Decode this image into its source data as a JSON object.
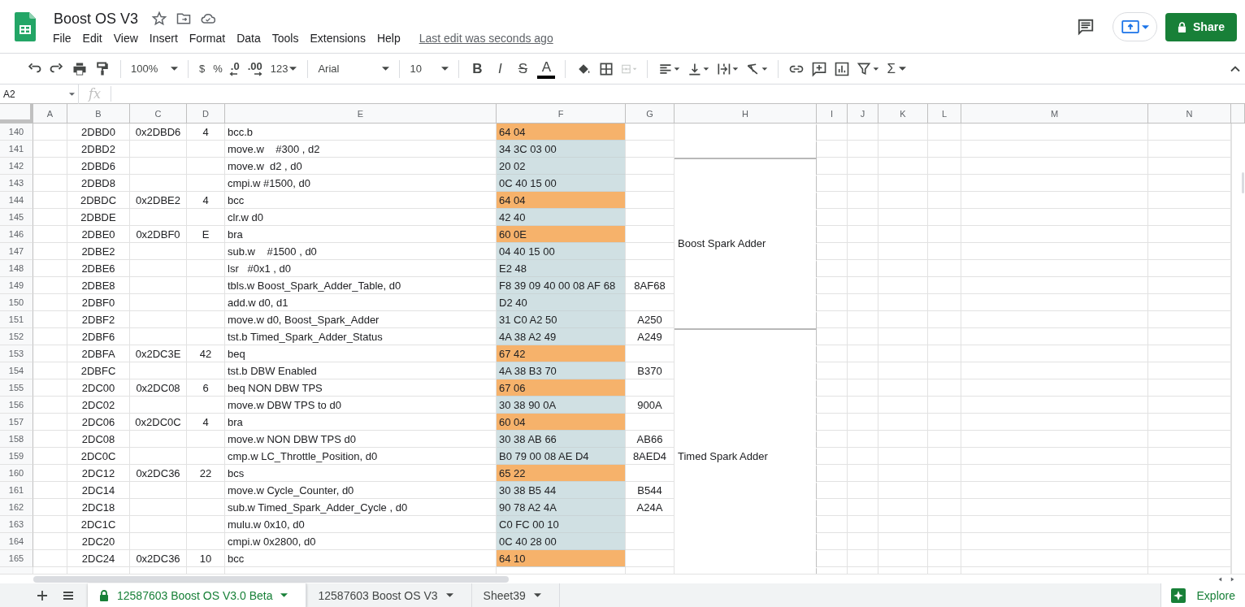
{
  "doc": {
    "title": "Boost OS V3",
    "menu": [
      "File",
      "Edit",
      "View",
      "Insert",
      "Format",
      "Data",
      "Tools",
      "Extensions",
      "Help"
    ],
    "last_edit": "Last edit was seconds ago",
    "share": "Share"
  },
  "toolbar": {
    "zoom": "100%",
    "currency": "$",
    "percent": "%",
    "dec_less": ".0",
    "dec_more": ".00",
    "more_formats": "123",
    "font": "Arial",
    "font_size": "10",
    "bold": "B",
    "italic": "I",
    "strike": "S",
    "text_color": "A",
    "functions": "Σ",
    "merge_disabled": true
  },
  "formula_bar": {
    "name_box": "A2",
    "fx": "fx"
  },
  "columns": [
    "A",
    "B",
    "C",
    "D",
    "E",
    "F",
    "G",
    "H",
    "I",
    "J",
    "K",
    "L",
    "M",
    "N"
  ],
  "rows": [
    {
      "num": "140",
      "b": "2DBD0",
      "c": "0x2DBD6",
      "d": "4",
      "e": "bcc.b",
      "f": "64 04",
      "color": "#f6b26b",
      "g": "",
      "h_merge": true,
      "h": ""
    },
    {
      "num": "141",
      "b": "2DBD2",
      "c": "",
      "d": "",
      "e": "move.w    #300 , d2",
      "f": "34 3C 03 00",
      "color": "#d0e0e3",
      "g": "",
      "h_merge": true,
      "h": ""
    },
    {
      "num": "142",
      "b": "2DBD6",
      "c": "",
      "d": "",
      "e": "move.w  d2 , d0",
      "f": "20 02",
      "color": "#d0e0e3",
      "g": "",
      "h_merge": false,
      "h": "Boost Spark Adder"
    },
    {
      "num": "143",
      "b": "2DBD8",
      "c": "",
      "d": "",
      "e": "cmpi.w #1500, d0",
      "f": "0C 40 15 00",
      "color": "#d0e0e3",
      "g": "",
      "h_merge": true,
      "h": ""
    },
    {
      "num": "144",
      "b": "2DBDC",
      "c": "0x2DBE2",
      "d": "4",
      "e": "bcc",
      "f": "64 04",
      "color": "#f6b26b",
      "g": "",
      "h_merge": true,
      "h": ""
    },
    {
      "num": "145",
      "b": "2DBDE",
      "c": "",
      "d": "",
      "e": "clr.w d0",
      "f": "42 40",
      "color": "#d0e0e3",
      "g": "",
      "h_merge": true,
      "h": ""
    },
    {
      "num": "146",
      "b": "2DBE0",
      "c": "0x2DBF0",
      "d": "E",
      "e": "bra",
      "f": "60 0E",
      "color": "#f6b26b",
      "g": "",
      "h_merge": true,
      "h": ""
    },
    {
      "num": "147",
      "b": "2DBE2",
      "c": "",
      "d": "",
      "e": "sub.w    #1500 , d0",
      "f": "04 40 15 00",
      "color": "#d0e0e3",
      "g": "",
      "h_merge": true,
      "h": ""
    },
    {
      "num": "148",
      "b": "2DBE6",
      "c": "",
      "d": "",
      "e": "lsr   #0x1 , d0",
      "f": "E2 48",
      "color": "#d0e0e3",
      "g": "",
      "h_merge": true,
      "h": ""
    },
    {
      "num": "149",
      "b": "2DBE8",
      "c": "",
      "d": "",
      "e": "tbls.w Boost_Spark_Adder_Table, d0",
      "f": "F8 39 09 40 00 08 AF 68",
      "color": "#d0e0e3",
      "g": "8AF68",
      "h_merge": true,
      "h": ""
    },
    {
      "num": "150",
      "b": "2DBF0",
      "c": "",
      "d": "",
      "e": "add.w d0, d1",
      "f": "D2 40",
      "color": "#d0e0e3",
      "g": "",
      "h_merge": true,
      "h": ""
    },
    {
      "num": "151",
      "b": "2DBF2",
      "c": "",
      "d": "",
      "e": "move.w d0, Boost_Spark_Adder",
      "f": "31 C0 A2 50",
      "color": "#d0e0e3",
      "g": "A250",
      "h_merge": true,
      "h": ""
    },
    {
      "num": "152",
      "b": "2DBF6",
      "c": "",
      "d": "",
      "e": "tst.b Timed_Spark_Adder_Status",
      "f": "4A 38 A2 49",
      "color": "#d0e0e3",
      "g": "A249",
      "h_merge": false,
      "h": "Timed Spark Adder"
    },
    {
      "num": "153",
      "b": "2DBFA",
      "c": "0x2DC3E",
      "d": "42",
      "e": "beq",
      "f": "67 42",
      "color": "#f6b26b",
      "g": "",
      "h_merge": true,
      "h": ""
    },
    {
      "num": "154",
      "b": "2DBFC",
      "c": "",
      "d": "",
      "e": "tst.b DBW Enabled",
      "f": "4A 38 B3 70",
      "color": "#d0e0e3",
      "g": "B370",
      "h_merge": true,
      "h": ""
    },
    {
      "num": "155",
      "b": "2DC00",
      "c": "0x2DC08",
      "d": "6",
      "e": "beq NON DBW TPS",
      "f": "67 06",
      "color": "#f6b26b",
      "g": "",
      "h_merge": true,
      "h": ""
    },
    {
      "num": "156",
      "b": "2DC02",
      "c": "",
      "d": "",
      "e": "move.w DBW TPS to d0",
      "f": "30 38 90 0A",
      "color": "#d0e0e3",
      "g": "900A",
      "h_merge": true,
      "h": ""
    },
    {
      "num": "157",
      "b": "2DC06",
      "c": "0x2DC0C",
      "d": "4",
      "e": "bra",
      "f": "60 04",
      "color": "#f6b26b",
      "g": "",
      "h_merge": true,
      "h": ""
    },
    {
      "num": "158",
      "b": "2DC08",
      "c": "",
      "d": "",
      "e": "move.w NON DBW TPS d0",
      "f": "30 38 AB 66",
      "color": "#d0e0e3",
      "g": "AB66",
      "h_merge": true,
      "h": ""
    },
    {
      "num": "159",
      "b": "2DC0C",
      "c": "",
      "d": "",
      "e": "cmp.w LC_Throttle_Position, d0",
      "f": "B0 79 00 08 AE D4",
      "color": "#d0e0e3",
      "g": "8AED4",
      "h_merge": true,
      "h": ""
    },
    {
      "num": "160",
      "b": "2DC12",
      "c": "0x2DC36",
      "d": "22",
      "e": "bcs",
      "f": "65 22",
      "color": "#f6b26b",
      "g": "",
      "h_merge": true,
      "h": ""
    },
    {
      "num": "161",
      "b": "2DC14",
      "c": "",
      "d": "",
      "e": "move.w Cycle_Counter, d0",
      "f": "30 38 B5 44",
      "color": "#d0e0e3",
      "g": "B544",
      "h_merge": true,
      "h": ""
    },
    {
      "num": "162",
      "b": "2DC18",
      "c": "",
      "d": "",
      "e": "sub.w Timed_Spark_Adder_Cycle , d0",
      "f": "90 78 A2 4A",
      "color": "#d0e0e3",
      "g": "A24A",
      "h_merge": true,
      "h": ""
    },
    {
      "num": "163",
      "b": "2DC1C",
      "c": "",
      "d": "",
      "e": "mulu.w 0x10, d0",
      "f": "C0 FC 00 10",
      "color": "#d0e0e3",
      "g": "",
      "h_merge": true,
      "h": ""
    },
    {
      "num": "164",
      "b": "2DC20",
      "c": "",
      "d": "",
      "e": "cmpi.w 0x2800, d0",
      "f": "0C 40 28 00",
      "color": "#d0e0e3",
      "g": "",
      "h_merge": true,
      "h": ""
    },
    {
      "num": "165",
      "b": "2DC24",
      "c": "0x2DC36",
      "d": "10",
      "e": "bcc",
      "f": "64 10",
      "color": "#f6b26b",
      "g": "",
      "h_merge": true,
      "h": ""
    }
  ],
  "sheet_tabs": [
    {
      "label": "12587603 Boost OS V3.0 Beta",
      "selected": true,
      "locked": true
    },
    {
      "label": "12587603 Boost OS V3",
      "selected": false,
      "locked": false
    },
    {
      "label": "Sheet39",
      "selected": false,
      "locked": false
    }
  ],
  "explore": "Explore"
}
